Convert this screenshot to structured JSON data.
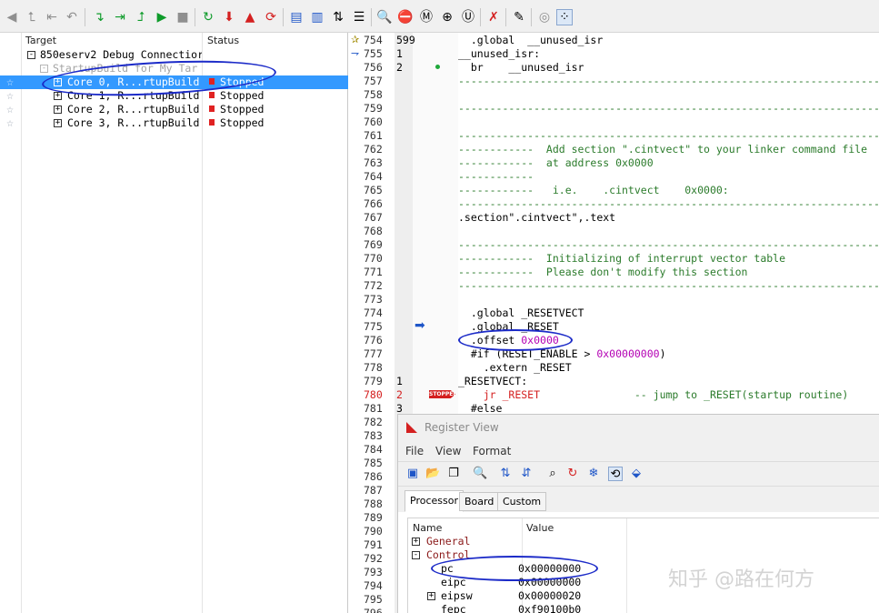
{
  "toolbar": {
    "icons": [
      "back-arrow",
      "step-out-arrow",
      "go-to-start",
      "step-back",
      "step-into",
      "step-over",
      "step-return",
      "run",
      "stop",
      "restart",
      "download",
      "load",
      "reload",
      "open-source",
      "save-source",
      "toggle-breakpoint",
      "breakpoint-list",
      "zoom-in",
      "stop-sign",
      "trace",
      "zoom",
      "find",
      "remove-breakpoints",
      "notes",
      "timer",
      "grid"
    ]
  },
  "left": {
    "col_target": "Target",
    "col_status": "Status",
    "connection": "850eserv2 Debug Connectior",
    "build_label": "StartupBuild for My Tar",
    "cores": [
      {
        "name": "Core 0, R...rtupBuild",
        "status": "Stopped",
        "selected": true
      },
      {
        "name": "Core 1, R...rtupBuild",
        "status": "Stopped",
        "selected": false
      },
      {
        "name": "Core 2, R...rtupBuild",
        "status": "Stopped",
        "selected": false
      },
      {
        "name": "Core 3, R...rtupBuild",
        "status": "Stopped",
        "selected": false
      }
    ]
  },
  "editor": {
    "lines": [
      {
        "n": "754",
        "c": "599",
        "text": "  .global  __unused_isr"
      },
      {
        "n": "755",
        "c": "1",
        "text": "__unused_isr:"
      },
      {
        "n": "756",
        "c": "2",
        "text": "  br    __unused_isr"
      },
      {
        "n": "757",
        "c": "",
        "text": "------------------------------------------------------------------------"
      },
      {
        "n": "758",
        "c": "",
        "text": ""
      },
      {
        "n": "759",
        "c": "",
        "text": "------------------------------------------------------------------------"
      },
      {
        "n": "760",
        "c": "",
        "text": ""
      },
      {
        "n": "761",
        "c": "",
        "text": "------------------------------------------------------------------------"
      },
      {
        "n": "762",
        "c": "",
        "text": "------------  Add section \".cintvect\" to your linker command file"
      },
      {
        "n": "763",
        "c": "",
        "text": "------------  at address 0x0000"
      },
      {
        "n": "764",
        "c": "",
        "text": "------------"
      },
      {
        "n": "765",
        "c": "",
        "text": "------------   i.e.    .cintvect    0x0000:"
      },
      {
        "n": "766",
        "c": "",
        "text": "------------------------------------------------------------------------"
      },
      {
        "n": "767",
        "c": "",
        "text": ".section\".cintvect\",.text"
      },
      {
        "n": "768",
        "c": "",
        "text": ""
      },
      {
        "n": "769",
        "c": "",
        "text": "------------------------------------------------------------------------"
      },
      {
        "n": "770",
        "c": "",
        "text": "------------  Initializing of interrupt vector table"
      },
      {
        "n": "771",
        "c": "",
        "text": "------------  Please don't modify this section"
      },
      {
        "n": "772",
        "c": "",
        "text": "------------------------------------------------------------------------"
      },
      {
        "n": "773",
        "c": "",
        "text": ""
      },
      {
        "n": "774",
        "c": "",
        "text": "  .global _RESETVECT"
      },
      {
        "n": "775",
        "c": "",
        "text": "  .global _RESET"
      },
      {
        "n": "776",
        "c": "",
        "text": "  .offset 0x0000"
      },
      {
        "n": "777",
        "c": "",
        "text": "  #if (RESET_ENABLE > 0x00000000)"
      },
      {
        "n": "778",
        "c": "",
        "text": "    .extern _RESET"
      },
      {
        "n": "779",
        "c": "1",
        "text": "_RESETVECT:"
      },
      {
        "n": "780",
        "c": "2",
        "text": "    jr _RESET               -- jump to _RESET(startup routine)"
      },
      {
        "n": "781",
        "c": "3",
        "text": "  #else"
      },
      {
        "n": "782",
        "c": "",
        "text": ""
      },
      {
        "n": "783",
        "c": "",
        "text": ""
      },
      {
        "n": "784",
        "c": "",
        "text": ""
      },
      {
        "n": "785",
        "c": "",
        "text": ""
      },
      {
        "n": "786",
        "c": "",
        "text": ""
      },
      {
        "n": "787",
        "c": "",
        "text": ""
      },
      {
        "n": "788",
        "c": "",
        "text": ""
      },
      {
        "n": "789",
        "c": "",
        "text": ""
      },
      {
        "n": "790",
        "c": "",
        "text": ""
      },
      {
        "n": "791",
        "c": "",
        "text": ""
      },
      {
        "n": "792",
        "c": "",
        "text": ""
      },
      {
        "n": "793",
        "c": "",
        "text": ""
      },
      {
        "n": "794",
        "c": "",
        "text": ""
      },
      {
        "n": "795",
        "c": "",
        "text": ""
      },
      {
        "n": "796",
        "c": "",
        "text": ""
      }
    ],
    "stopped_marker": "STOPPED"
  },
  "register_view": {
    "title": "Register View",
    "menu": [
      "File",
      "View",
      "Format"
    ],
    "tabs": [
      "Processor",
      "Board",
      "Custom"
    ],
    "col_name": "Name",
    "col_value": "Value",
    "rows": [
      {
        "name": "General",
        "value": "",
        "group": true,
        "expander": "+"
      },
      {
        "name": "Control",
        "value": "",
        "group": true,
        "expander": "-"
      },
      {
        "name": "pc",
        "value": "0x00000000",
        "group": false,
        "expander": ""
      },
      {
        "name": "eipc",
        "value": "0x00000000",
        "group": false,
        "expander": ""
      },
      {
        "name": "eipsw",
        "value": "0x00000020",
        "group": false,
        "expander": "+"
      },
      {
        "name": "fepc",
        "value": "0xf90100b0",
        "group": false,
        "expander": ""
      }
    ]
  },
  "watermark": "知乎 @路在何方",
  "colors": {
    "selection": "#3399ff",
    "annotation": "#1c2bc8",
    "stopped_red": "#d42020",
    "comment_green": "#2b7b2b",
    "hex_magenta": "#b400b4"
  }
}
